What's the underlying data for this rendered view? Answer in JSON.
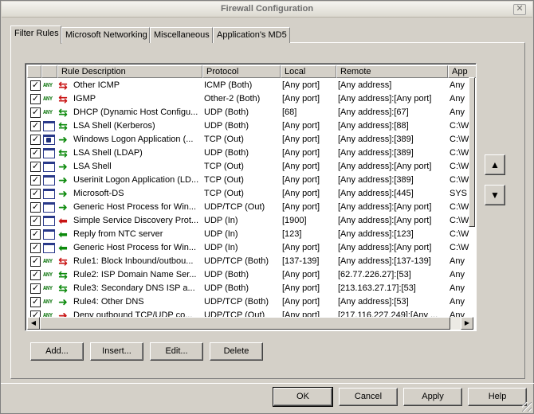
{
  "window": {
    "title": "Firewall Configuration",
    "close_label": "✕"
  },
  "tabs": [
    {
      "label": "Filter Rules",
      "active": true
    },
    {
      "label": "Microsoft Networking",
      "active": false
    },
    {
      "label": "Miscellaneous",
      "active": false
    },
    {
      "label": "Application's MD5",
      "active": false
    }
  ],
  "list": {
    "columns": [
      "Rule Description",
      "Protocol",
      "Local",
      "Remote",
      "App"
    ],
    "rows": [
      {
        "checked": true,
        "icon": "any",
        "dir": "both-red",
        "desc": "Other ICMP",
        "protocol": "ICMP (Both)",
        "local": "[Any port]",
        "remote": "[Any address]",
        "app": "Any"
      },
      {
        "checked": true,
        "icon": "any",
        "dir": "both-red",
        "desc": "IGMP",
        "protocol": "Other-2 (Both)",
        "local": "[Any port]",
        "remote": "[Any address]:[Any port]",
        "app": "Any"
      },
      {
        "checked": true,
        "icon": "any",
        "dir": "both-green",
        "desc": "DHCP (Dynamic Host Configu...",
        "protocol": "UDP (Both)",
        "local": "[68]",
        "remote": "[Any address]:[67]",
        "app": "Any"
      },
      {
        "checked": true,
        "icon": "app",
        "dir": "both-green",
        "desc": "LSA Shell (Kerberos)",
        "protocol": "UDP (Both)",
        "local": "[Any port]",
        "remote": "[Any address]:[88]",
        "app": "C:\\W"
      },
      {
        "checked": true,
        "icon": "lock",
        "dir": "out-green",
        "desc": "Windows Logon Application (...",
        "protocol": "TCP (Out)",
        "local": "[Any port]",
        "remote": "[Any address]:[389]",
        "app": "C:\\W"
      },
      {
        "checked": true,
        "icon": "app",
        "dir": "both-green",
        "desc": "LSA Shell (LDAP)",
        "protocol": "UDP (Both)",
        "local": "[Any port]",
        "remote": "[Any address]:[389]",
        "app": "C:\\W"
      },
      {
        "checked": true,
        "icon": "app",
        "dir": "out-green",
        "desc": "LSA Shell",
        "protocol": "TCP (Out)",
        "local": "[Any port]",
        "remote": "[Any address]:[Any port]",
        "app": "C:\\W"
      },
      {
        "checked": true,
        "icon": "app",
        "dir": "out-green",
        "desc": "Userinit Logon Application (LD...",
        "protocol": "TCP (Out)",
        "local": "[Any port]",
        "remote": "[Any address]:[389]",
        "app": "C:\\W"
      },
      {
        "checked": true,
        "icon": "app",
        "dir": "out-green",
        "desc": "Microsoft-DS",
        "protocol": "TCP (Out)",
        "local": "[Any port]",
        "remote": "[Any address]:[445]",
        "app": "SYS"
      },
      {
        "checked": true,
        "icon": "app",
        "dir": "out-green",
        "desc": "Generic Host Process for Win...",
        "protocol": "UDP/TCP (Out)",
        "local": "[Any port]",
        "remote": "[Any address]:[Any port]",
        "app": "C:\\W"
      },
      {
        "checked": true,
        "icon": "app",
        "dir": "in-red",
        "desc": "Simple Service Discovery Prot...",
        "protocol": "UDP (In)",
        "local": "[1900]",
        "remote": "[Any address]:[Any port]",
        "app": "C:\\W"
      },
      {
        "checked": true,
        "icon": "app",
        "dir": "in-green",
        "desc": "Reply from NTC server",
        "protocol": "UDP (In)",
        "local": "[123]",
        "remote": "[Any address]:[123]",
        "app": "C:\\W"
      },
      {
        "checked": true,
        "icon": "app",
        "dir": "in-green",
        "desc": "Generic Host Process for Win...",
        "protocol": "UDP (In)",
        "local": "[Any port]",
        "remote": "[Any address]:[Any port]",
        "app": "C:\\W"
      },
      {
        "checked": true,
        "icon": "any",
        "dir": "both-red",
        "desc": "Rule1: Block Inbound/outbou...",
        "protocol": "UDP/TCP (Both)",
        "local": "[137-139]",
        "remote": "[Any address]:[137-139]",
        "app": "Any"
      },
      {
        "checked": true,
        "icon": "any",
        "dir": "both-green",
        "desc": "Rule2: ISP Domain Name Ser...",
        "protocol": "UDP (Both)",
        "local": "[Any port]",
        "remote": "[62.77.226.27]:[53]",
        "app": "Any"
      },
      {
        "checked": true,
        "icon": "any",
        "dir": "both-green",
        "desc": "Rule3: Secondary DNS ISP a...",
        "protocol": "UDP (Both)",
        "local": "[Any port]",
        "remote": "[213.163.27.17]:[53]",
        "app": "Any"
      },
      {
        "checked": true,
        "icon": "any",
        "dir": "out-green",
        "desc": "Rule4: Other DNS",
        "protocol": "UDP/TCP (Both)",
        "local": "[Any port]",
        "remote": "[Any address]:[53]",
        "app": "Any"
      },
      {
        "checked": true,
        "icon": "any",
        "dir": "out-red",
        "desc": "Deny outbound TCP/UDP co...",
        "protocol": "UDP/TCP (Out)",
        "local": "[Any port]",
        "remote": "[217.116.227.249]:[Any ...",
        "app": "Any"
      }
    ]
  },
  "move_buttons": {
    "up": "▲",
    "down": "▼"
  },
  "rule_buttons": {
    "add": "Add...",
    "insert": "Insert...",
    "edit": "Edit...",
    "delete": "Delete"
  },
  "dialog_buttons": {
    "ok": "OK",
    "cancel": "Cancel",
    "apply": "Apply",
    "help": "Help"
  },
  "colors": {
    "allow": "#0c8a0c",
    "deny": "#c81414",
    "any_text": "#1b7d1b"
  }
}
